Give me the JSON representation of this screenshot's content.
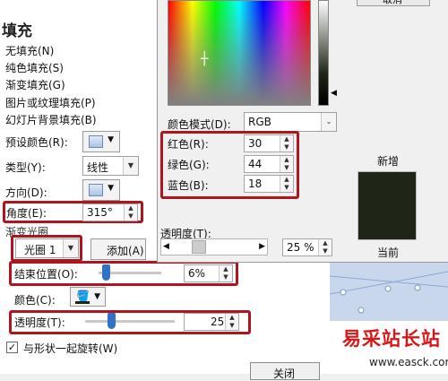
{
  "panel": {
    "title": "填充",
    "fill_options": [
      "无填充(N)",
      "纯色填充(S)",
      "渐变填充(G)",
      "图片或纹理填充(P)",
      "幻灯片背景填充(B)"
    ],
    "preset_label": "预设颜色(R):",
    "type_label": "类型(Y):",
    "type_value": "线性",
    "direction_label": "方向(D):",
    "angle_label": "角度(E):",
    "angle_value": "315°",
    "gradient_stops_label": "渐变光圈",
    "stop_select_value": "光圈 1",
    "add_button": "添加(A)",
    "end_position_label": "结束位置(O):",
    "end_position_value": "6%",
    "end_position_fraction": 0.06,
    "color_label": "颜色(C):",
    "transparency_label": "透明度(T):",
    "transparency_value": "25%",
    "transparency_fraction": 0.25,
    "rotate_checkbox_label": "与形状一起旋转(W)",
    "rotate_checked": true,
    "close_button": "关闭"
  },
  "dialog": {
    "cancel_button": "取消",
    "color_mode_label": "颜色模式(D):",
    "color_mode_value": "RGB",
    "red_label": "红色(R):",
    "red_value": "30",
    "green_label": "绿色(G):",
    "green_value": "44",
    "blue_label": "蓝色(B):",
    "blue_value": "18",
    "new_label": "新增",
    "current_label": "当前",
    "transparency_label": "透明度(T):",
    "transparency_value": "25 %",
    "transparency_fraction": 0.25,
    "preview_color": "#1f2618"
  },
  "watermark": {
    "line1": "易采站长站",
    "line2": "www.easck.com"
  },
  "colors": {
    "highlight": "#b0141f",
    "slider_thumb": "#2f73c9"
  }
}
